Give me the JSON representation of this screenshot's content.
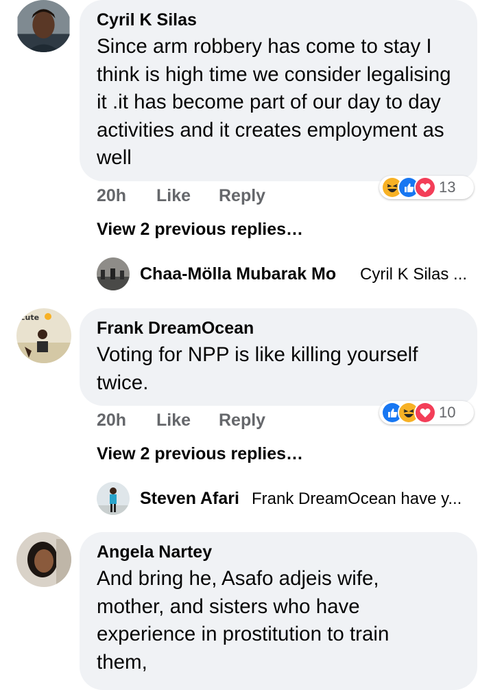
{
  "comments": [
    {
      "name": "Cyril K Silas",
      "text": "Since arm robbery has come to stay I think is high time we consider legalising it .it has become part of our day to day activities and it creates employment as well",
      "time": "20h",
      "like": "Like",
      "reply": "Reply",
      "reaction_count": "13",
      "reactions": [
        "haha-icon",
        "like-icon",
        "love-icon"
      ],
      "view_previous": "View 2 previous replies…",
      "latest_reply": {
        "name": "Chaa-Mölla Mubarak Mo",
        "snippet": "Cyril K Silas ..."
      }
    },
    {
      "name": "Frank DreamOcean",
      "text": "Voting for NPP is like killing yourself twice.",
      "time": "20h",
      "like": "Like",
      "reply": "Reply",
      "reaction_count": "10",
      "reactions": [
        "like-icon",
        "haha-icon",
        "love-icon"
      ],
      "view_previous": "View 2 previous replies…",
      "latest_reply": {
        "name": "Steven Afari",
        "snippet": "Frank DreamOcean have y..."
      }
    },
    {
      "name": "Angela Nartey",
      "text": "And bring he, Asafo adjeis wife, mother, and sisters  who have experience in prostitution to train them,"
    }
  ],
  "colors": {
    "bubble": "#f0f2f5",
    "meta": "#65676b",
    "like": "#1877f2",
    "love": "#f33e58",
    "haha": "#f7b125"
  }
}
